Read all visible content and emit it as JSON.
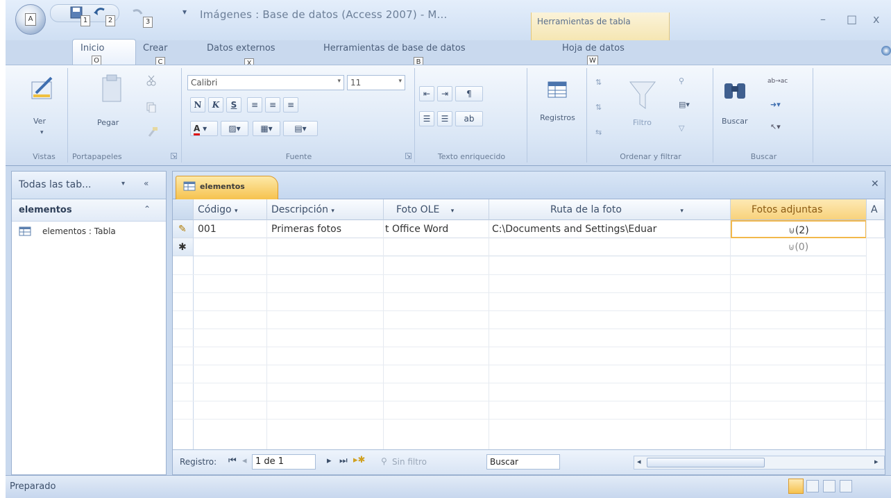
{
  "window": {
    "title": "Imágenes : Base de datos (Access 2007) - M...",
    "contextual_tab": "Herramientas de tabla",
    "min": "–",
    "max": "□",
    "close": "x"
  },
  "qat": {
    "keytips": [
      "A",
      "1",
      "2",
      "3"
    ]
  },
  "ribbon_tabs": [
    {
      "label": "Inicio",
      "keytip": "O"
    },
    {
      "label": "Crear",
      "keytip": "C"
    },
    {
      "label": "Datos externos",
      "keytip": "X"
    },
    {
      "label": "Herramientas de base de datos",
      "keytip": "B"
    },
    {
      "label": "Hoja de datos",
      "keytip": "W"
    }
  ],
  "groups": {
    "vistas": {
      "label": "Vistas",
      "ver": "Ver"
    },
    "portapapeles": {
      "label": "Portapapeles",
      "pegar": "Pegar"
    },
    "fuente": {
      "label": "Fuente",
      "font_name": "Calibri",
      "font_size": "11",
      "bold": "N",
      "italic": "K",
      "underline": "S"
    },
    "texto": {
      "label": "Texto enriquecido"
    },
    "registros": {
      "label": "Registros"
    },
    "ordenar": {
      "label": "Ordenar y filtrar",
      "filtro": "Filtro"
    },
    "buscar": {
      "label": "Buscar",
      "buscar": "Buscar"
    }
  },
  "nav": {
    "header": "Todas las tab...",
    "group": "elementos",
    "item": "elementos : Tabla"
  },
  "doc_tab": "elementos",
  "columns": [
    "Código",
    "Descripción",
    "Foto OLE",
    "Ruta de la foto",
    "Fotos adjuntas",
    "A"
  ],
  "rows": [
    {
      "codigo": "001",
      "descripcion": "Primeras fotos",
      "foto_ole": "t Office Word",
      "ruta": "C:\\Documents and Settings\\Eduar",
      "adjuntas": "(2)"
    }
  ],
  "new_row": {
    "adjuntas": "(0)"
  },
  "record_nav": {
    "label": "Registro:",
    "position": "1 de 1",
    "filter": "Sin filtro",
    "search": "Buscar"
  },
  "status": "Preparado"
}
